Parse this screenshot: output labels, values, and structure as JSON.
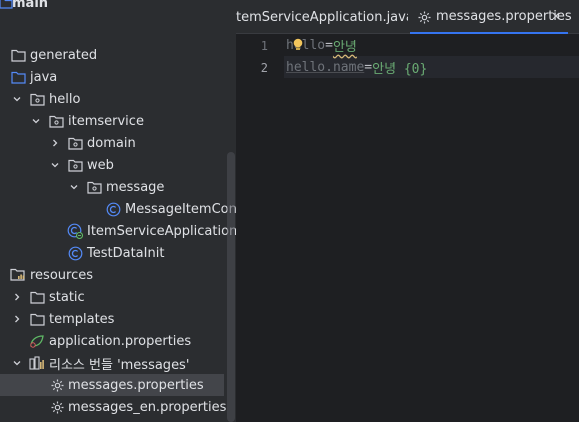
{
  "tree": {
    "items": [
      {
        "label": "main",
        "icon": "folder-icon"
      },
      {
        "label": "generated",
        "icon": "folder-icon"
      },
      {
        "label": "java",
        "icon": "source-folder-icon"
      },
      {
        "label": "hello",
        "icon": "package-icon"
      },
      {
        "label": "itemservice",
        "icon": "package-icon"
      },
      {
        "label": "domain",
        "icon": "package-icon"
      },
      {
        "label": "web",
        "icon": "package-icon"
      },
      {
        "label": "message",
        "icon": "package-icon"
      },
      {
        "label": "MessageItemCont",
        "icon": "class-icon"
      },
      {
        "label": "ItemServiceApplication",
        "icon": "spring-class-icon"
      },
      {
        "label": "TestDataInit",
        "icon": "class-icon"
      },
      {
        "label": "resources",
        "icon": "resources-folder-icon"
      },
      {
        "label": "static",
        "icon": "folder-icon"
      },
      {
        "label": "templates",
        "icon": "folder-icon"
      },
      {
        "label": "application.properties",
        "icon": "spring-properties-icon"
      },
      {
        "label": "리소스 번들 'messages'",
        "icon": "resource-bundle-icon"
      },
      {
        "label": "messages.properties",
        "icon": "properties-gear-icon"
      },
      {
        "label": "messages_en.properties",
        "icon": "properties-gear-icon"
      }
    ]
  },
  "tabs": [
    {
      "label": "itemServiceApplication.java",
      "visible_label": "temServiceApplication.java",
      "active": false
    },
    {
      "label": "messages.properties",
      "active": true
    }
  ],
  "editor": {
    "line_numbers": [
      "1",
      "2"
    ],
    "lines": [
      {
        "key": "hello",
        "eq": "=",
        "value": "안녕"
      },
      {
        "key": "hello.name",
        "eq": "=",
        "value": "안녕 {0}"
      }
    ]
  },
  "colors": {
    "accent": "#3574f0",
    "tree_bg": "#2b2d30",
    "editor_bg": "#1e1f22",
    "selection": "#43454a",
    "prop_value": "#6aab73",
    "prop_key": "#6f737a"
  }
}
